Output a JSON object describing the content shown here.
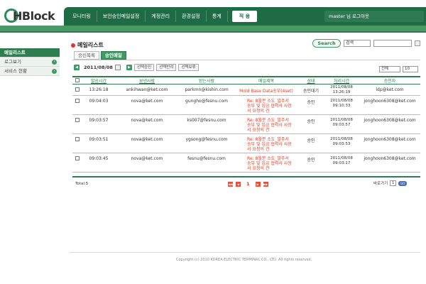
{
  "logo": {
    "text": "HBlock"
  },
  "nav": {
    "items": [
      "모니터링",
      "보안승인메일설정",
      "계정관리",
      "환경설정",
      "통계"
    ],
    "active": "적 용"
  },
  "user": {
    "text": "master 님 로그아웃"
  },
  "sidebar": {
    "items": [
      {
        "label": "메일리스트",
        "active": true
      },
      {
        "label": "로그보기",
        "active": false
      },
      {
        "label": "서비스 현황",
        "active": false
      }
    ]
  },
  "page": {
    "title": "메일리스트"
  },
  "search": {
    "button": "Search",
    "select": "검색"
  },
  "tabs": [
    {
      "label": "승신목록",
      "active": false
    },
    {
      "label": "승인메일",
      "active": true
    }
  ],
  "datebar": {
    "date": "2011/08/08",
    "actions": [
      "선택승인",
      "선택반려",
      "선택보류"
    ]
  },
  "filters": {
    "status": "전체",
    "count": "10"
  },
  "table": {
    "headers": [
      "발송시간",
      "보낸사람",
      "받는사람",
      "메일제목",
      "상태",
      "처리시간",
      "승인자"
    ],
    "rows": [
      {
        "time": "13:26:18",
        "from": "ankihwan@ket.com",
        "to": "parkmn@kishin.com",
        "subject": "Mold Base Data송부(4set)",
        "status": "승인대기",
        "processed": "2011/08/08\n13:26:19",
        "approver": "ldp@ket.com"
      },
      {
        "time": "09:04:03",
        "from": "nova@ket.com",
        "to": "gungho@fesnu.com",
        "subject": "Re: 8월분 소도_발주서 송부 및 입금 협력사 사항서 요청의 건",
        "status": "승인",
        "processed": "2011/08/08\n09:10:33",
        "approver": "jonghoon6308@ket.com"
      },
      {
        "time": "09:03:57",
        "from": "nova@ket.com",
        "to": "ks007@fesnu.com",
        "subject": "Re: 8월분 소도_발주서 송부 및 입금 협력사 사항서 요청의 건",
        "status": "승인",
        "processed": "2011/08/08\n09:03:57",
        "approver": "jonghoon6308@ket.com"
      },
      {
        "time": "09:03:51",
        "from": "nova@ket.com",
        "to": "ygsong@fesnu.com",
        "subject": "Re: 8월분 소도_발주서 송부 및 입금 협력사 사항서 요청의 건",
        "status": "승인",
        "processed": "2011/08/08\n09:03:53",
        "approver": "jonghoon6308@ket.com"
      },
      {
        "time": "09:03:45",
        "from": "nova@ket.com",
        "to": "fesnu@fesnu.com",
        "subject": "Re: 8월분 소도_발주서 송부 및 입금 협력사 사항서 요청의 건",
        "status": "승인",
        "processed": "2011/08/08\n09:03:17",
        "approver": "jonghoon6308@ket.com"
      }
    ]
  },
  "footer": {
    "total": "Total:5",
    "page": "1",
    "goto_label": "바로가기",
    "goto_value": "1",
    "go": "GO",
    "copyright": "Copyright (c) 2010 KOREA ELECTRIC TERMINAL CO., LTD. All rights reserved."
  }
}
